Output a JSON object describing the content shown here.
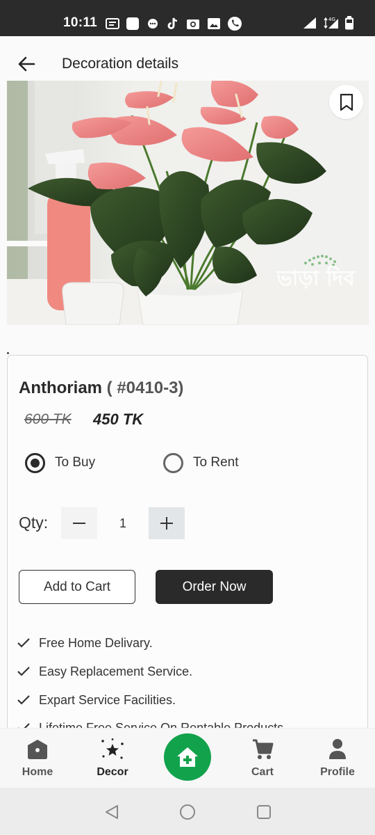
{
  "status_bar": {
    "time": "10:11",
    "network": "4G"
  },
  "header": {
    "title": "Decoration details"
  },
  "image": {
    "alt": "Anthurium plant with pink flowers",
    "watermark": "ভাড়া দিব"
  },
  "product": {
    "name": "Anthoriam",
    "code": "( #0410-3)",
    "old_price": "600 TK",
    "new_price": "450 TK"
  },
  "purchase_options": [
    {
      "label": "To Buy",
      "selected": true
    },
    {
      "label": "To Rent",
      "selected": false
    }
  ],
  "quantity": {
    "label": "Qty:",
    "value": "1"
  },
  "actions": {
    "add_to_cart": "Add to Cart",
    "order_now": "Order Now"
  },
  "features": [
    "Free Home Delivary.",
    "Easy Replacement Service.",
    "Expart Service Facilities.",
    "Lifetime Free Service On Rentable Products"
  ],
  "bottom_nav": {
    "items": [
      {
        "label": "Home",
        "icon": "home-icon",
        "active": false
      },
      {
        "label": "Decor",
        "icon": "decor-icon",
        "active": true
      },
      {
        "label": "Cart",
        "icon": "cart-icon",
        "active": false
      },
      {
        "label": "Profile",
        "icon": "profile-icon",
        "active": false
      }
    ],
    "fab_icon": "add-home-icon"
  },
  "colors": {
    "accent_green": "#12a24c",
    "dark": "#2a2a2a",
    "status_bar": "#2b2b2b"
  }
}
